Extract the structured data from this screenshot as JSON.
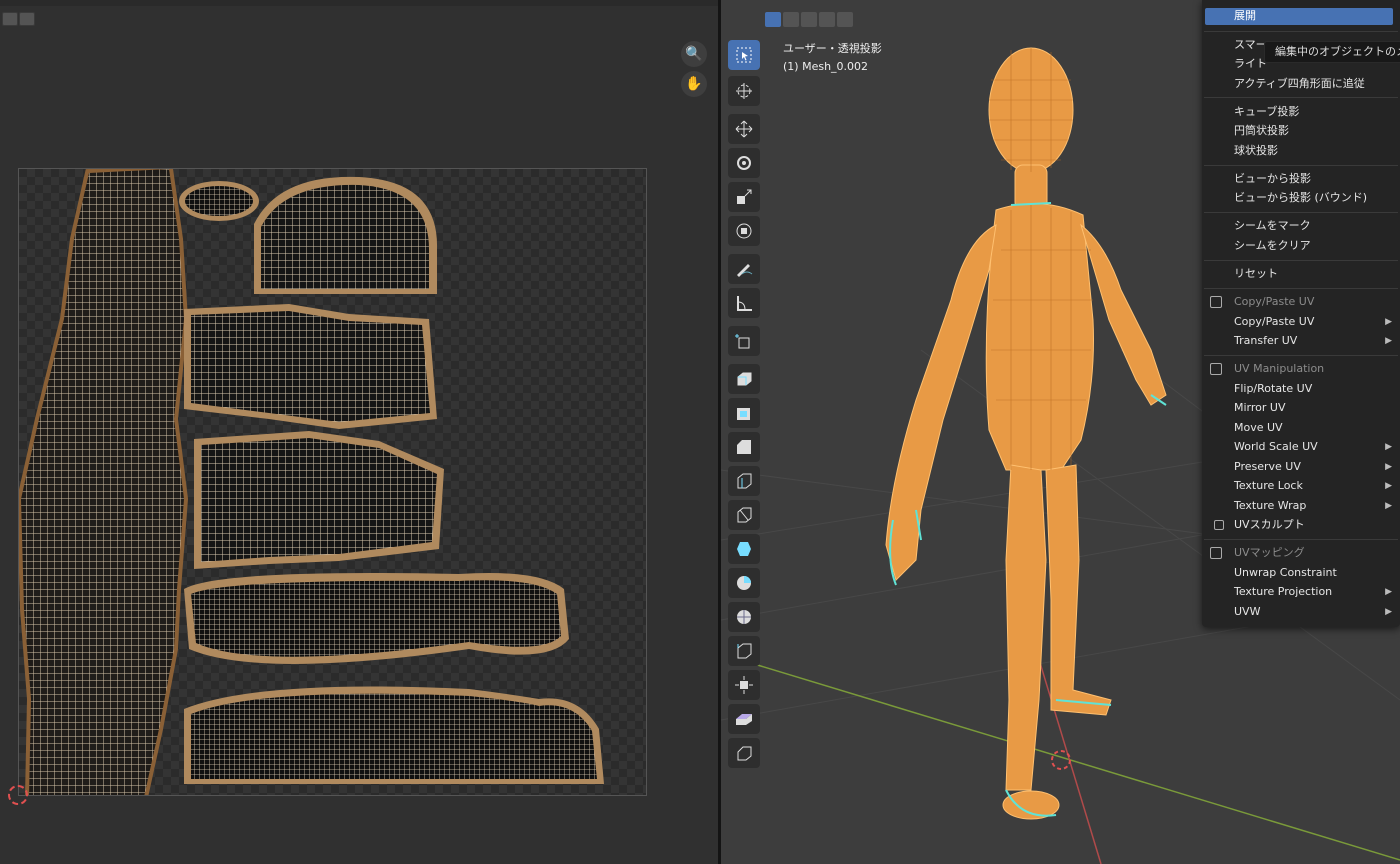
{
  "viewport": {
    "view_name": "ユーザー・透視投影",
    "object_name": "(1) Mesh_0.002"
  },
  "menu": {
    "items": [
      {
        "label": "展開"
      },
      {
        "label": "スマー"
      },
      {
        "label": "ライト"
      },
      {
        "label": "アクティブ四角形面に追従"
      },
      {
        "label": "キューブ投影"
      },
      {
        "label": "円筒状投影"
      },
      {
        "label": "球状投影"
      },
      {
        "label": "ビューから投影"
      },
      {
        "label": "ビューから投影 (バウンド)"
      },
      {
        "label": "シームをマーク"
      },
      {
        "label": "シームをクリア"
      },
      {
        "label": "リセット"
      },
      {
        "label": "Copy/Paste UV"
      },
      {
        "label": "Copy/Paste UV"
      },
      {
        "label": "Transfer UV"
      },
      {
        "label": "UV Manipulation"
      },
      {
        "label": "Flip/Rotate UV"
      },
      {
        "label": "Mirror UV"
      },
      {
        "label": "Move UV"
      },
      {
        "label": "World Scale UV"
      },
      {
        "label": "Preserve UV"
      },
      {
        "label": "Texture Lock"
      },
      {
        "label": "Texture Wrap"
      },
      {
        "label": "UVスカルプト"
      },
      {
        "label": "UVマッピング"
      },
      {
        "label": "Unwrap Constraint"
      },
      {
        "label": "Texture Projection"
      },
      {
        "label": "UVW"
      }
    ]
  },
  "tooltip": "編集中のオブジェクトのメ",
  "colors": {
    "active_menu_bg": "#4772b3",
    "mesh_orange": "#f0a23c",
    "seam_cyan": "#5fe3d6",
    "grid_green": "#6a8a2a",
    "grid_red": "#a83a3a"
  }
}
